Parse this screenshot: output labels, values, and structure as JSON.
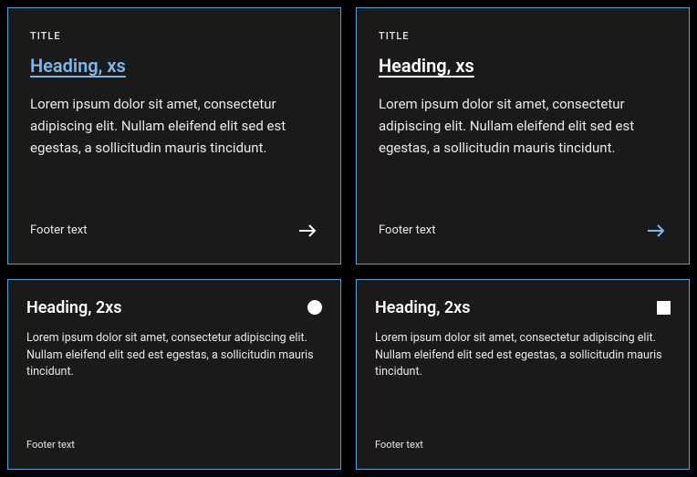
{
  "cards": [
    {
      "title": "TITLE",
      "heading": "Heading, xs",
      "body": "Lorem ipsum dolor sit amet, consectetur adipiscing elit. Nullam eleifend elit sed est egestas, a sollicitudin mauris tincidunt.",
      "footer": "Footer text"
    },
    {
      "title": "TITLE",
      "heading": "Heading, xs",
      "body": "Lorem ipsum dolor sit amet, consectetur adipiscing elit. Nullam eleifend elit sed est egestas, a sollicitudin mauris tincidunt.",
      "footer": "Footer text"
    },
    {
      "heading": "Heading, 2xs",
      "body": "Lorem ipsum dolor sit amet, consectetur adipiscing elit. Nullam eleifend elit sed est egestas, a sollicitudin mauris tincidunt.",
      "footer": "Footer text"
    },
    {
      "heading": "Heading, 2xs",
      "body": "Lorem ipsum dolor sit amet, consectetur adipiscing elit. Nullam eleifend elit sed est egestas, a sollicitudin mauris tincidunt.",
      "footer": "Footer text"
    }
  ]
}
